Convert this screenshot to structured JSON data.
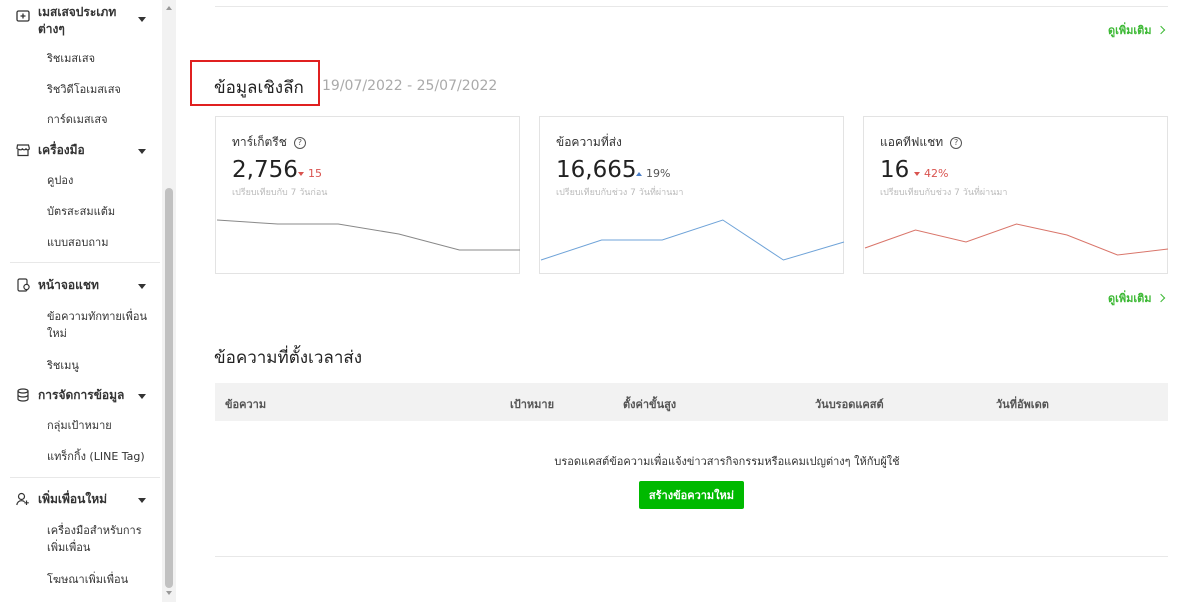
{
  "sidebar": {
    "sections": [
      {
        "label": "เมสเสจประเภทต่างๆ",
        "icon": "message-plus-icon",
        "items": [
          "ริชเมสเสจ",
          "ริชวิดีโอเมสเสจ",
          "การ์ดเมสเสจ"
        ]
      },
      {
        "label": "เครื่องมือ",
        "icon": "shop-icon",
        "items": [
          "คูปอง",
          "บัตรสะสมแต้ม",
          "แบบสอบถาม"
        ]
      },
      {
        "label": "หน้าจอแชท",
        "icon": "chat-screen-icon",
        "items": [
          "ข้อความทักทายเพื่อนใหม่",
          "ริชเมนู"
        ]
      },
      {
        "label": "การจัดการข้อมูล",
        "icon": "database-icon",
        "items": [
          "กลุ่มเป้าหมาย",
          "แทร็กกิ้ง (LINE Tag)"
        ]
      },
      {
        "label": "เพิ่มเพื่อนใหม่",
        "icon": "add-friend-icon",
        "items": [
          "เครื่องมือสำหรับการเพิ่มเพื่อน",
          "โฆษณาเพิ่มเพื่อน"
        ]
      }
    ]
  },
  "main": {
    "see_more": "ดูเพิ่มเติม",
    "insight": {
      "title": "ข้อมูลเชิงลึก",
      "date_range": "19/07/2022 - 25/07/2022",
      "cards": [
        {
          "title": "ทาร์เก็ตรีช",
          "value": "2,756",
          "delta": "15",
          "direction": "down",
          "sub": "เปรียบเทียบกับ 7 วันก่อน",
          "color": "#888888",
          "trend": [
            5,
            4.6,
            4.6,
            3.6,
            2,
            2
          ]
        },
        {
          "title": "ข้อความที่ส่ง",
          "value": "16,665",
          "delta": "19%",
          "direction": "up",
          "sub": "เปรียบเทียบกับช่วง 7 วันที่ผ่านมา",
          "color": "#6fa3d8",
          "trend": [
            1,
            3,
            3,
            5,
            1,
            2.8
          ]
        },
        {
          "title": "แอคทีฟแชท",
          "value": "16",
          "delta": "42%",
          "direction": "down",
          "sub": "เปรียบเทียบกับช่วง 7 วันที่ผ่านมา",
          "color": "#d9756a",
          "trend": [
            2.2,
            4,
            2.8,
            4.6,
            3.5,
            1.5,
            2.1
          ]
        }
      ]
    },
    "scheduled": {
      "title": "ข้อความที่ตั้งเวลาส่ง",
      "columns": [
        "ข้อความ",
        "เป้าหมาย",
        "ตั้งค่าขั้นสูง",
        "วันบรอดแคสต์",
        "วันที่อัพเดต"
      ],
      "empty_message": "บรอดแคสต์ข้อความเพื่อแจ้งข่าวสารกิจกรรมหรือแคมเปญต่างๆ ให้กับผู้ใช้",
      "create_button": "สร้างข้อความใหม่"
    }
  }
}
